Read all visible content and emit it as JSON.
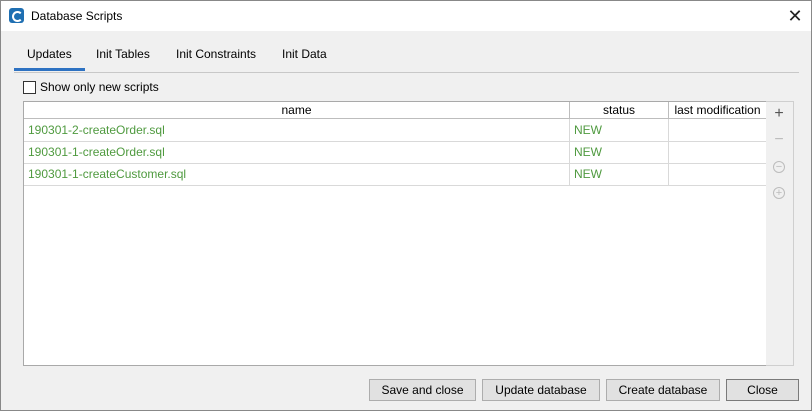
{
  "window": {
    "title": "Database Scripts",
    "close_glyph": "✕"
  },
  "tabs": [
    {
      "label": "Updates",
      "active": true
    },
    {
      "label": "Init Tables",
      "active": false
    },
    {
      "label": "Init Constraints",
      "active": false
    },
    {
      "label": "Init Data",
      "active": false
    }
  ],
  "filter": {
    "show_new_label": "Show only new scripts",
    "checked": false
  },
  "table": {
    "columns": [
      "name",
      "status",
      "last modification"
    ],
    "rows": [
      {
        "name": "190301-2-createOrder.sql",
        "status": "NEW",
        "last_modification": ""
      },
      {
        "name": "190301-1-createOrder.sql",
        "status": "NEW",
        "last_modification": ""
      },
      {
        "name": "190301-1-createCustomer.sql",
        "status": "NEW",
        "last_modification": ""
      }
    ],
    "row_text_color": "#4f9a3f"
  },
  "side_tools": [
    {
      "icon": "plus-icon",
      "glyph": "+"
    },
    {
      "icon": "minus-icon",
      "glyph": "−"
    },
    {
      "icon": "remove-circle-icon",
      "glyph": "−"
    },
    {
      "icon": "add-circle-icon",
      "glyph": "+"
    }
  ],
  "buttons": {
    "save_and_close": "Save and close",
    "update_database": "Update database",
    "create_database": "Create database",
    "close": "Close"
  },
  "colors": {
    "accent": "#2e72c2",
    "new_status": "#4f9a3f"
  }
}
